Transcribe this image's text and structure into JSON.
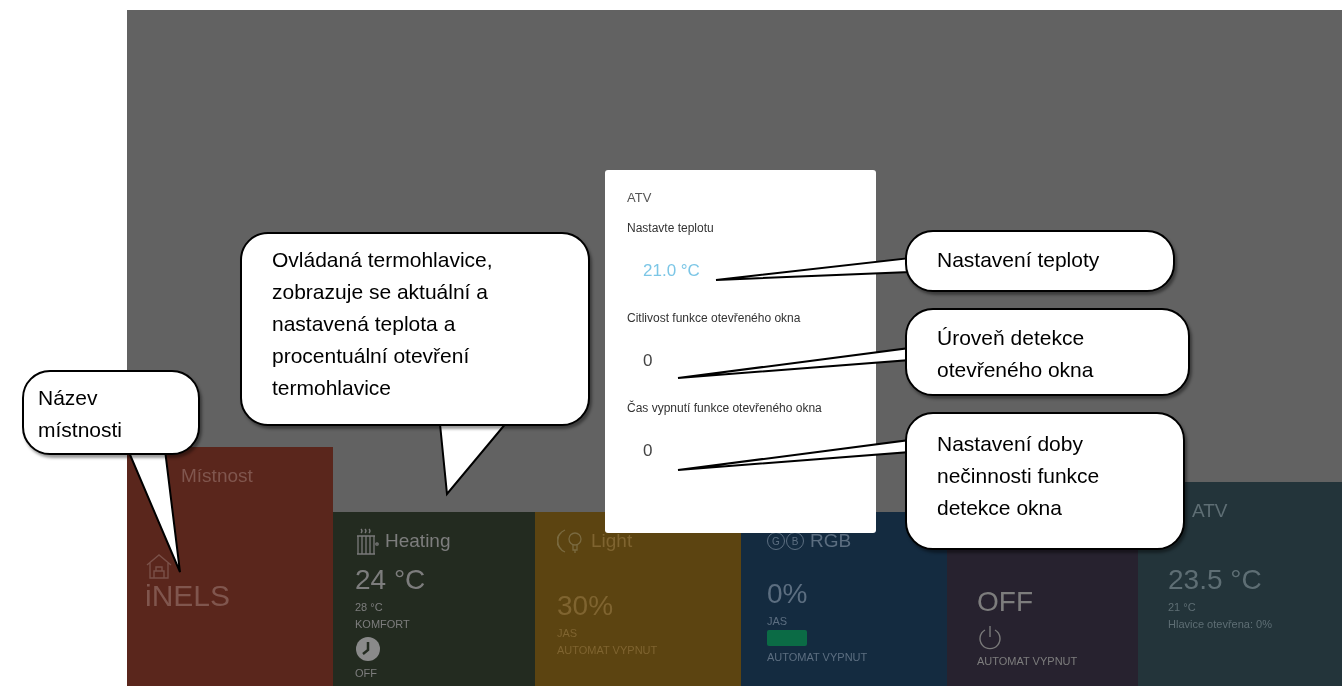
{
  "tiles": [
    {
      "kind": "room",
      "title": "Místnost",
      "value": "iNELS"
    },
    {
      "kind": "heating",
      "title": "Heating",
      "value": "24 °C",
      "details": [
        "28 °C",
        "KOMFORT"
      ],
      "status": "OFF"
    },
    {
      "kind": "light",
      "title": "Light",
      "value": "30%",
      "details": [
        "JAS",
        "AUTOMAT VYPNUT"
      ]
    },
    {
      "kind": "rgb",
      "title": "RGB",
      "letters": [
        "G",
        "B"
      ],
      "value": "0%",
      "details": [
        "JAS"
      ],
      "color": "#0b6b45",
      "status": "AUTOMAT VYPNUT"
    },
    {
      "kind": "switch",
      "value": "OFF",
      "status": "AUTOMAT VYPNUT"
    },
    {
      "kind": "atv",
      "title": "ATV",
      "value": "23.5 °C",
      "details": [
        "21 °C",
        "Hlavice otevřena: 0%"
      ]
    }
  ],
  "dialog": {
    "title": "ATV",
    "fields": [
      {
        "label": "Nastavte teplotu",
        "value": "21.0 °C",
        "kind": "temperature"
      },
      {
        "label": "Citlivost funkce otevřeného okna",
        "value": "0",
        "kind": "number"
      },
      {
        "label": "Čas vypnutí funkce otevřeného okna",
        "value": "0",
        "kind": "number"
      }
    ]
  },
  "callouts": [
    {
      "text": "Název místnosti"
    },
    {
      "text": "Ovládaná termohlavice, zobrazuje se aktuální a nastavená teplota a procentuální otevření termohlavice"
    },
    {
      "text": "Nastavení teploty"
    },
    {
      "text": "Úroveň detekce otevřeného okna"
    },
    {
      "text": "Nastavení doby nečinnosti funkce detekce okna"
    }
  ]
}
